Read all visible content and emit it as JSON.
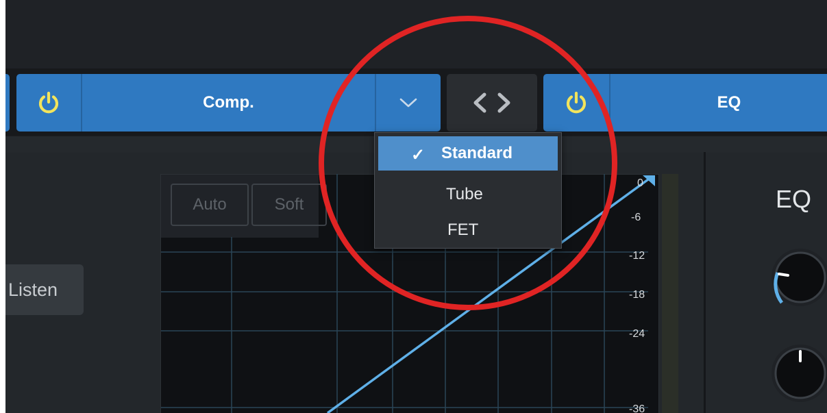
{
  "modules": {
    "comp": {
      "title": "Comp."
    },
    "eq": {
      "title": "EQ"
    }
  },
  "dropdown": {
    "options": [
      {
        "label": "Standard",
        "selected": true,
        "check": "✓"
      },
      {
        "label": "Tube",
        "selected": false
      },
      {
        "label": "FET",
        "selected": false
      }
    ]
  },
  "side": {
    "listen_label": "Listen"
  },
  "graph": {
    "mode_buttons": [
      "Auto",
      "Soft"
    ],
    "db_scale": [
      "0",
      "-6",
      "-12",
      "-18",
      "-24",
      "-36"
    ]
  },
  "eq_panel": {
    "label": "EQ"
  },
  "colors": {
    "module_blue": "#2f79c1",
    "power_yellow": "#f2e45c",
    "curve_blue": "#5fb0e8",
    "highlight_red": "#e02424",
    "dropdown_selected": "#4f8fcb"
  }
}
